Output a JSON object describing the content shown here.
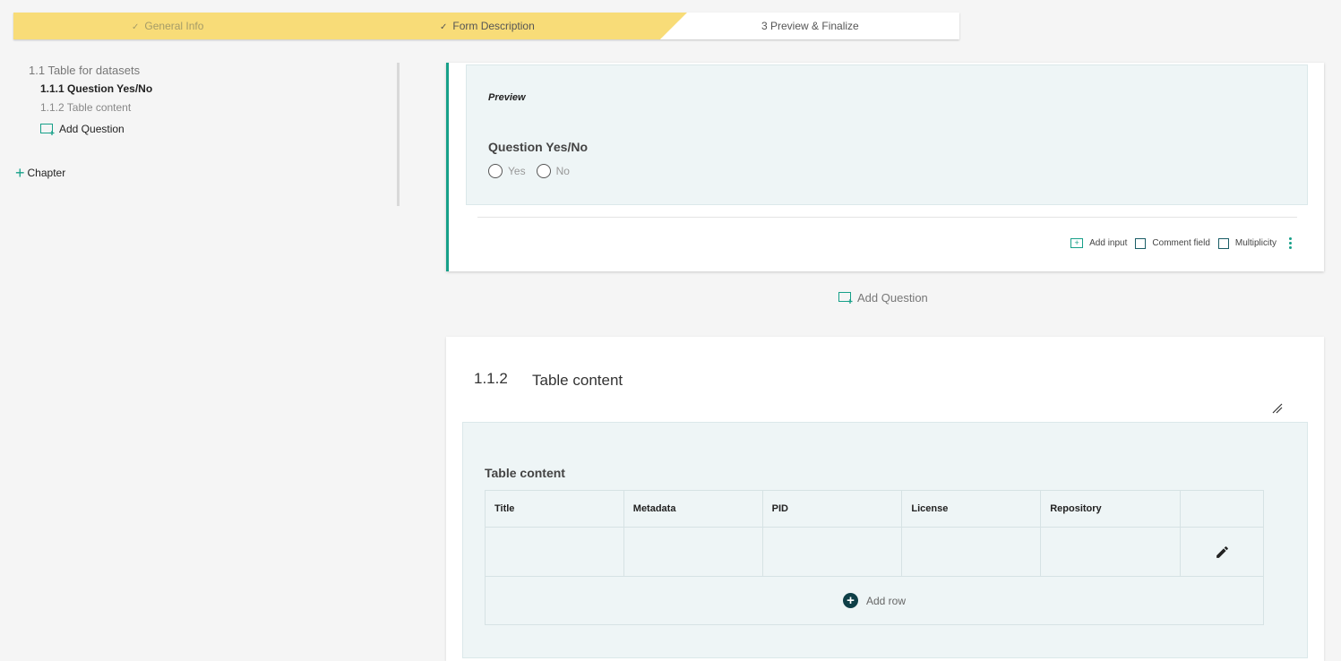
{
  "stepper": {
    "steps": [
      {
        "label": "General Info",
        "state": "done"
      },
      {
        "label": "Form Description",
        "state": "done"
      },
      {
        "label": "3 Preview & Finalize",
        "state": "current"
      }
    ],
    "check_glyph": "✓"
  },
  "sidebar": {
    "section": "1.1 Table for datasets",
    "items": [
      {
        "label": "1.1.1 Question Yes/No",
        "active": true
      },
      {
        "label": "1.1.2 Table content",
        "active": false
      }
    ],
    "add_question": "Add Question",
    "add_chapter": "Chapter"
  },
  "question1": {
    "preview_label": "Preview",
    "title": "Question Yes/No",
    "options": [
      "Yes",
      "No"
    ],
    "footer": {
      "add_input": "Add input",
      "comment_field": "Comment field",
      "multiplicity": "Multiplicity"
    }
  },
  "add_question_center": "Add Question",
  "question2": {
    "number": "1.1.2",
    "title": "Table content",
    "preview_title": "Table content",
    "columns": [
      "Title",
      "Metadata",
      "PID",
      "License",
      "Repository"
    ],
    "add_row": "Add row"
  },
  "colors": {
    "accent": "#17a089",
    "stepper_done": "#f8dc78",
    "preview_bg": "#eef5f6",
    "dark_teal": "#0e3f47"
  }
}
